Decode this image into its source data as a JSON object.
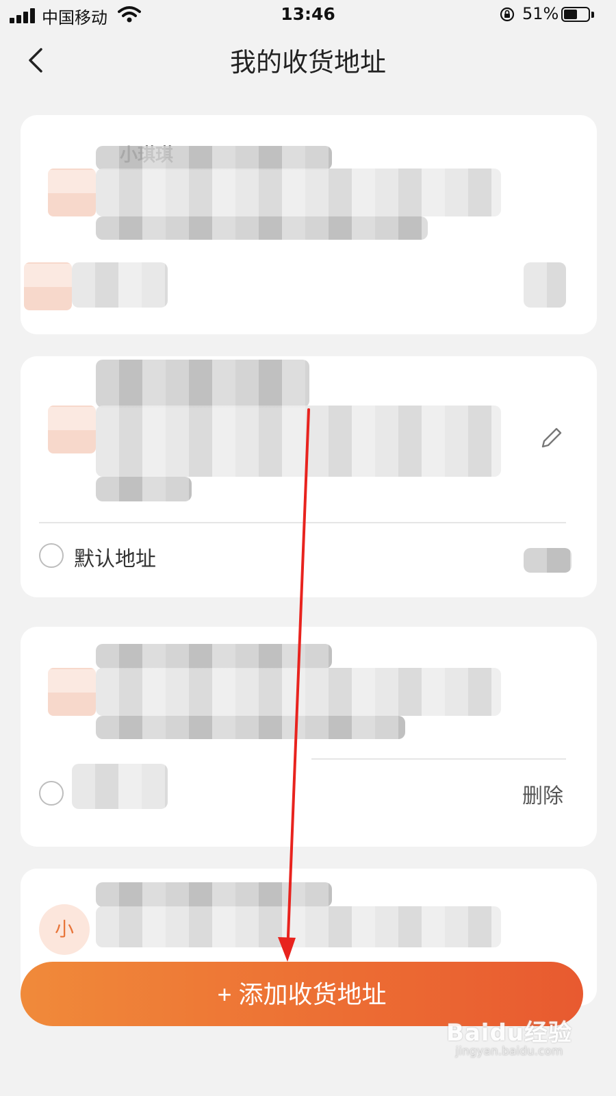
{
  "status_bar": {
    "carrier": "中国移动",
    "time": "13:46",
    "battery_percent": "51%"
  },
  "nav": {
    "title": "我的收货地址"
  },
  "cards": [
    {
      "name_visible": "小琪琪"
    },
    {
      "default_label": "默认地址"
    },
    {
      "delete_label": "删除"
    },
    {
      "avatar_initial": "小"
    }
  ],
  "add_button": {
    "label": "+ 添加收货地址"
  },
  "watermark": {
    "logo": "Baidu经验",
    "url": "jingyan.baidu.com"
  },
  "colors": {
    "accent_start": "#f08a3a",
    "accent_end": "#e85a30",
    "annotation": "#e8231e"
  }
}
